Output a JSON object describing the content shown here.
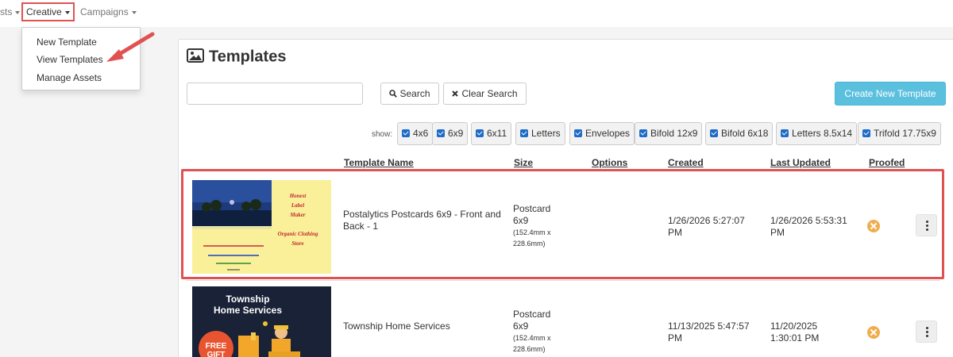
{
  "nav": {
    "assets_label": "sts",
    "creative_label": "Creative",
    "campaigns_label": "Campaigns"
  },
  "dropdown": {
    "items": [
      {
        "label": "New Template"
      },
      {
        "label": "View Templates"
      },
      {
        "label": "Manage Assets"
      }
    ]
  },
  "panel": {
    "title": "Templates",
    "search_value": "",
    "search_button": "Search",
    "clear_button": "Clear Search",
    "create_button": "Create New Template",
    "show_label": "show:",
    "filters": [
      {
        "label": "4x6",
        "checked": true
      },
      {
        "label": "6x9",
        "checked": true
      },
      {
        "label": "6x11",
        "checked": true
      },
      {
        "label": "Letters",
        "checked": true
      },
      {
        "label": "Envelopes",
        "checked": true
      },
      {
        "label": "Bifold 12x9",
        "checked": true
      },
      {
        "label": "Bifold 6x18",
        "checked": true
      },
      {
        "label": "Letters 8.5x14",
        "checked": true
      },
      {
        "label": "Trifold 17.75x9",
        "checked": true
      }
    ]
  },
  "table": {
    "headers": {
      "name": "Template Name",
      "size": "Size",
      "options": "Options",
      "created": "Created",
      "updated": "Last Updated",
      "proofed": "Proofed"
    },
    "rows": [
      {
        "name": "Postalytics Postcards 6x9 - Front and Back - 1",
        "size_type": "Postcard",
        "size_dims": "6x9",
        "size_mm": "(152.4mm x 228.6mm)",
        "created": "1/26/2026 5:27:07 PM",
        "updated": "1/26/2026 5:53:31 PM",
        "proofed": false,
        "thumb_text": [
          "Honest",
          "Label",
          "Maker",
          "Organic Clothing",
          "Store"
        ]
      },
      {
        "name": "Township Home Services",
        "size_type": "Postcard",
        "size_dims": "6x9",
        "size_mm": "(152.4mm x 228.6mm)",
        "created": "11/13/2025 5:47:57 PM",
        "updated": "11/20/2025 1:30:01 PM",
        "proofed": false,
        "thumb_text": [
          "Township",
          "Home Services",
          "FREE",
          "GIFT"
        ]
      }
    ]
  },
  "colors": {
    "highlight": "#e05252",
    "primary_info": "#5bc0de",
    "checkbox": "#1e6cc8",
    "not_proofed": "#f0ad4e"
  }
}
